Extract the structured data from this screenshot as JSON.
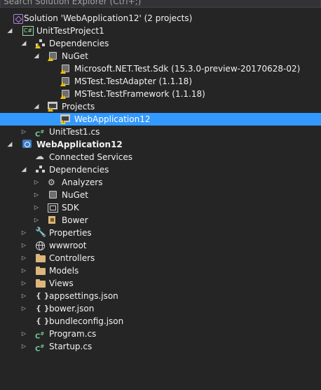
{
  "search": {
    "placeholder": "Search Solution Explorer (Ctrl+;)"
  },
  "tree": [
    {
      "label": "Solution 'WebApplication12' (2 projects)",
      "icon": "solution-icon",
      "expander": ""
    },
    {
      "label": "UnitTestProject1",
      "icon": "csharp-project-icon",
      "expander": "open"
    },
    {
      "label": "Dependencies",
      "icon": "dependencies-warning-icon",
      "expander": "open"
    },
    {
      "label": "NuGet",
      "icon": "nuget-warning-icon",
      "expander": "open"
    },
    {
      "label": "Microsoft.NET.Test.Sdk (15.3.0-preview-20170628-02)",
      "icon": "package-warning-icon",
      "expander": ""
    },
    {
      "label": "MSTest.TestAdapter (1.1.18)",
      "icon": "package-warning-icon",
      "expander": ""
    },
    {
      "label": "MSTest.TestFramework (1.1.18)",
      "icon": "package-warning-icon",
      "expander": ""
    },
    {
      "label": "Projects",
      "icon": "projects-warning-icon",
      "expander": "open"
    },
    {
      "label": "WebApplication12",
      "icon": "project-reference-warning-icon",
      "expander": ""
    },
    {
      "label": "UnitTest1.cs",
      "icon": "csharp-file-icon",
      "expander": "closed"
    },
    {
      "label": "WebApplication12",
      "icon": "web-project-icon",
      "expander": "open"
    },
    {
      "label": "Connected Services",
      "icon": "connected-services-icon",
      "expander": ""
    },
    {
      "label": "Dependencies",
      "icon": "dependencies-icon",
      "expander": "open"
    },
    {
      "label": "Analyzers",
      "icon": "analyzers-icon",
      "expander": "closed"
    },
    {
      "label": "NuGet",
      "icon": "nuget-icon",
      "expander": "closed"
    },
    {
      "label": "SDK",
      "icon": "sdk-icon",
      "expander": "closed"
    },
    {
      "label": "Bower",
      "icon": "bower-icon",
      "expander": "closed"
    },
    {
      "label": "Properties",
      "icon": "wrench-icon",
      "expander": "closed"
    },
    {
      "label": "wwwroot",
      "icon": "globe-icon",
      "expander": "closed"
    },
    {
      "label": "Controllers",
      "icon": "folder-icon",
      "expander": "closed"
    },
    {
      "label": "Models",
      "icon": "folder-icon",
      "expander": "closed"
    },
    {
      "label": "Views",
      "icon": "folder-icon",
      "expander": "closed"
    },
    {
      "label": "appsettings.json",
      "icon": "json-file-icon",
      "expander": "closed"
    },
    {
      "label": "bower.json",
      "icon": "json-file-icon",
      "expander": "closed"
    },
    {
      "label": "bundleconfig.json",
      "icon": "json-file-icon",
      "expander": ""
    },
    {
      "label": "Program.cs",
      "icon": "csharp-file-icon",
      "expander": "closed"
    },
    {
      "label": "Startup.cs",
      "icon": "csharp-file-icon",
      "expander": "closed"
    }
  ],
  "selected_item": "WebApplication12 (project reference)",
  "colors": {
    "background": "#252526",
    "selection": "#3399ff",
    "warning": "#f2c811",
    "folder": "#dcb67a"
  }
}
